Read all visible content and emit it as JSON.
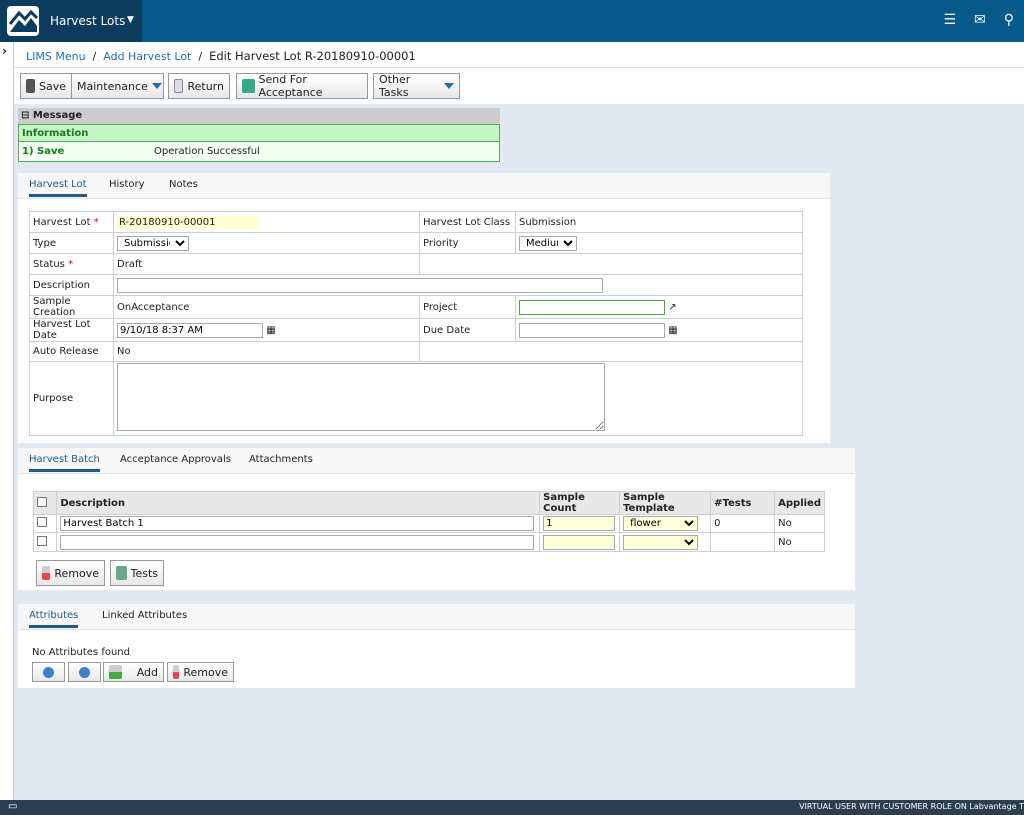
{
  "app": {
    "module": "Harvest Lots",
    "footer": "VIRTUAL USER WITH CUSTOMER ROLE ON Labvantage T"
  },
  "breadcrumb": {
    "items": [
      "LIMS Menu",
      "Add Harvest Lot"
    ],
    "current": "Edit Harvest Lot R-20180910-00001"
  },
  "toolbar": {
    "save": "Save",
    "maintenance": "Maintenance",
    "return": "Return",
    "send": "Send For Acceptance",
    "other": "Other Tasks"
  },
  "message": {
    "title": "Message",
    "header": "Information",
    "item": "1) Save",
    "text": "Operation Successful"
  },
  "lot_tabs": [
    "Harvest Lot",
    "History",
    "Notes"
  ],
  "form": {
    "harvest_lot_label": "Harvest Lot",
    "harvest_lot": "R-20180910-00001",
    "class_label": "Harvest Lot Class",
    "class": "Submission",
    "type_label": "Type",
    "type": "Submission",
    "priority_label": "Priority",
    "priority": "Medium",
    "status_label": "Status",
    "status": "Draft",
    "description_label": "Description",
    "description": "",
    "sample_creation_label": "Sample Creation",
    "sample_creation": "OnAcceptance",
    "project_label": "Project",
    "project": "",
    "date_label": "Harvest Lot Date",
    "date": "9/10/18 8:37 AM",
    "due_label": "Due Date",
    "due": "",
    "auto_label": "Auto Release",
    "auto": "No",
    "purpose_label": "Purpose",
    "purpose": ""
  },
  "batch_tabs": [
    "Harvest Batch",
    "Acceptance Approvals",
    "Attachments"
  ],
  "batch": {
    "columns": [
      "Description",
      "Sample Count",
      "Sample Template",
      "#Tests",
      "Applied"
    ],
    "rows": [
      {
        "description": "Harvest Batch 1",
        "count": "1",
        "template": "flower",
        "tests": "0",
        "applied": "No"
      },
      {
        "description": "",
        "count": "",
        "template": "",
        "tests": "",
        "applied": "No"
      }
    ],
    "remove": "Remove",
    "tests": "Tests"
  },
  "attr_tabs": [
    "Attributes",
    "Linked Attributes"
  ],
  "attributes": {
    "empty": "No Attributes found",
    "add": "Add",
    "remove": "Remove"
  }
}
